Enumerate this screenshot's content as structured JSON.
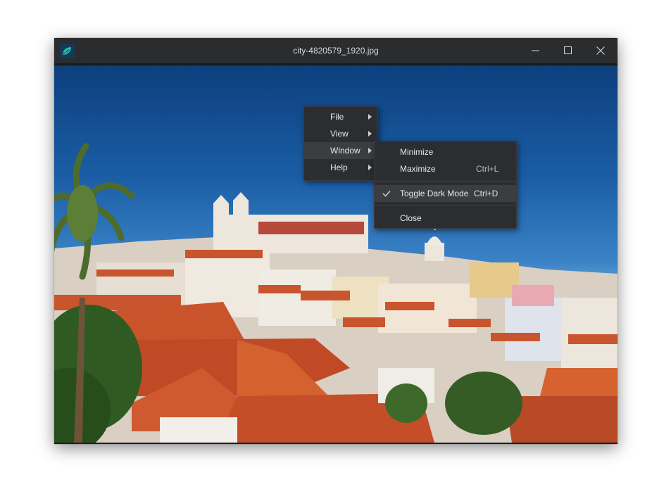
{
  "window": {
    "title": "city-4820579_1920.jpg",
    "app_icon": "leaf-app-icon",
    "controls": [
      "minimize-icon",
      "maximize-icon",
      "close-icon"
    ]
  },
  "menu": {
    "items": [
      {
        "label": "File",
        "has_submenu": true
      },
      {
        "label": "View",
        "has_submenu": true
      },
      {
        "label": "Window",
        "has_submenu": true,
        "active": true
      },
      {
        "label": "Help",
        "has_submenu": true
      }
    ]
  },
  "submenu": {
    "items": [
      {
        "label": "Minimize",
        "shortcut": ""
      },
      {
        "label": "Maximize",
        "shortcut": "Ctrl+L"
      },
      {
        "label": "Toggle Dark Mode",
        "shortcut": "Ctrl+D",
        "checked": true
      },
      {
        "label": "Close",
        "shortcut": ""
      }
    ]
  },
  "colors": {
    "titlebar": "#2b2c2e",
    "menu_bg": "#2c2d30",
    "menu_active": "#3c3d41",
    "accent": "#1fb5a0"
  }
}
